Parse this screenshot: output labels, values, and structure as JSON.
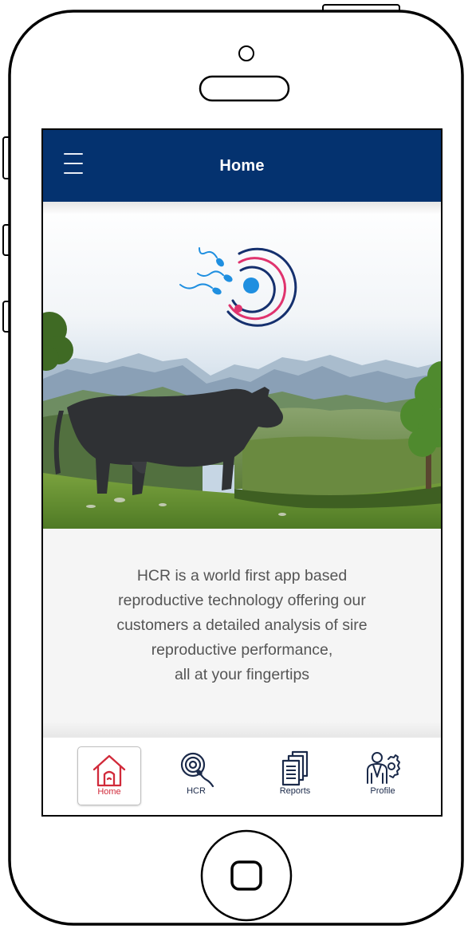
{
  "header": {
    "title": "Home",
    "menu_icon": "hamburger-menu-icon"
  },
  "hero": {
    "logo_icon": "sperm-target-logo-icon",
    "image": "cow-in-mountain-landscape"
  },
  "main": {
    "description": "HCR is a world first app based\nreproductive technology offering our\ncustomers a detailed analysis of sire\nreproductive performance,\nall at your fingertips"
  },
  "bottom_nav": {
    "active": "Home",
    "items": [
      {
        "label": "Home",
        "icon": "home-icon"
      },
      {
        "label": "HCR",
        "icon": "hcr-icon"
      },
      {
        "label": "Reports",
        "icon": "reports-icon"
      },
      {
        "label": "Profile",
        "icon": "profile-icon"
      }
    ]
  },
  "colors": {
    "app_bar": "#04326f",
    "active_accent": "#d12a3a",
    "logo_blue": "#1f8fe0",
    "logo_pink": "#e0336e",
    "logo_navy": "#15306e"
  }
}
